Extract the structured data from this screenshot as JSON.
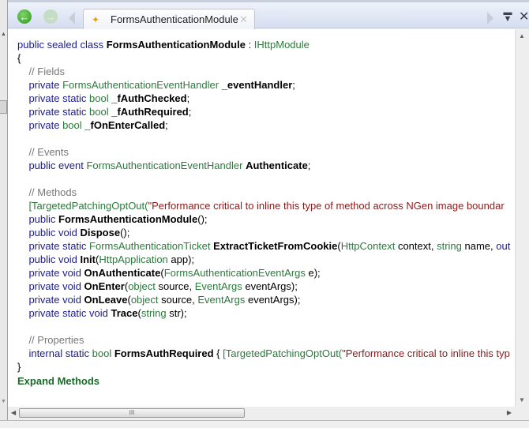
{
  "tab": {
    "label": "FormsAuthenticationModule",
    "icon": "class-icon"
  },
  "code": [
    [
      [
        "kw",
        "public sealed class "
      ],
      [
        "b",
        "FormsAuthenticationModule"
      ],
      [
        "p",
        " : "
      ],
      [
        "ty",
        "IHttpModule"
      ]
    ],
    [
      [
        "p",
        "{"
      ]
    ],
    [
      [
        "cm",
        "    // Fields"
      ]
    ],
    [
      [
        "kw",
        "    private "
      ],
      [
        "ty",
        "FormsAuthenticationEventHandler "
      ],
      [
        "b",
        "_eventHandler"
      ],
      [
        "p",
        ";"
      ]
    ],
    [
      [
        "kw",
        "    private static "
      ],
      [
        "ty",
        "bool "
      ],
      [
        "b",
        "_fAuthChecked"
      ],
      [
        "p",
        ";"
      ]
    ],
    [
      [
        "kw",
        "    private static "
      ],
      [
        "ty",
        "bool "
      ],
      [
        "b",
        "_fAuthRequired"
      ],
      [
        "p",
        ";"
      ]
    ],
    [
      [
        "kw",
        "    private "
      ],
      [
        "ty",
        "bool "
      ],
      [
        "b",
        "_fOnEnterCalled"
      ],
      [
        "p",
        ";"
      ]
    ],
    [],
    [
      [
        "cm",
        "    // Events"
      ]
    ],
    [
      [
        "kw",
        "    public event "
      ],
      [
        "ty",
        "FormsAuthenticationEventHandler "
      ],
      [
        "b",
        "Authenticate"
      ],
      [
        "p",
        ";"
      ]
    ],
    [],
    [
      [
        "cm",
        "    // Methods"
      ]
    ],
    [
      [
        "ty",
        "    [TargetedPatchingOptOut("
      ],
      [
        "st",
        "\"Performance critical to inline this type of method across NGen image boundar"
      ]
    ],
    [
      [
        "kw",
        "    public "
      ],
      [
        "b",
        "FormsAuthenticationModule"
      ],
      [
        "p",
        "();"
      ]
    ],
    [
      [
        "kw",
        "    public void "
      ],
      [
        "b",
        "Dispose"
      ],
      [
        "p",
        "();"
      ]
    ],
    [
      [
        "kw",
        "    private static "
      ],
      [
        "ty",
        "FormsAuthenticationTicket "
      ],
      [
        "b",
        "ExtractTicketFromCookie"
      ],
      [
        "p",
        "("
      ],
      [
        "ty",
        "HttpContext "
      ],
      [
        "p",
        "context, "
      ],
      [
        "ty",
        "string "
      ],
      [
        "p",
        "name, "
      ],
      [
        "kw",
        "out"
      ]
    ],
    [
      [
        "kw",
        "    public void "
      ],
      [
        "b",
        "Init"
      ],
      [
        "p",
        "("
      ],
      [
        "ty",
        "HttpApplication "
      ],
      [
        "p",
        "app);"
      ]
    ],
    [
      [
        "kw",
        "    private void "
      ],
      [
        "b",
        "OnAuthenticate"
      ],
      [
        "p",
        "("
      ],
      [
        "ty",
        "FormsAuthenticationEventArgs "
      ],
      [
        "p",
        "e);"
      ]
    ],
    [
      [
        "kw",
        "    private void "
      ],
      [
        "b",
        "OnEnter"
      ],
      [
        "p",
        "("
      ],
      [
        "ty",
        "object "
      ],
      [
        "p",
        "source, "
      ],
      [
        "ty",
        "EventArgs "
      ],
      [
        "p",
        "eventArgs);"
      ]
    ],
    [
      [
        "kw",
        "    private void "
      ],
      [
        "b",
        "OnLeave"
      ],
      [
        "p",
        "("
      ],
      [
        "ty",
        "object "
      ],
      [
        "p",
        "source, "
      ],
      [
        "ty",
        "EventArgs "
      ],
      [
        "p",
        "eventArgs);"
      ]
    ],
    [
      [
        "kw",
        "    private static void "
      ],
      [
        "b",
        "Trace"
      ],
      [
        "p",
        "("
      ],
      [
        "ty",
        "string "
      ],
      [
        "p",
        "str);"
      ]
    ],
    [],
    [
      [
        "cm",
        "    // Properties"
      ]
    ],
    [
      [
        "kw",
        "    internal static "
      ],
      [
        "ty",
        "bool "
      ],
      [
        "b",
        "FormsAuthRequired"
      ],
      [
        "p",
        " { "
      ],
      [
        "ty",
        "[TargetedPatchingOptOut("
      ],
      [
        "st",
        "\"Performance critical to inline this typ"
      ]
    ],
    [
      [
        "p",
        "}"
      ]
    ]
  ],
  "expand_label": "Expand Methods",
  "hscroll_grip": "III"
}
